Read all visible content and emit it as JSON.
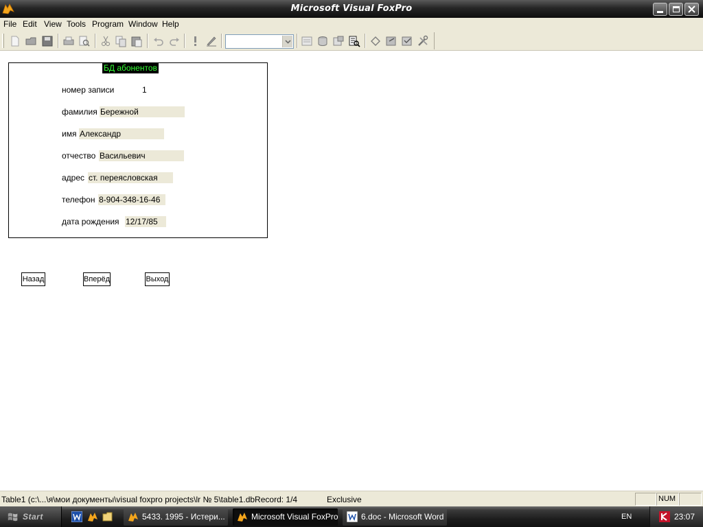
{
  "window": {
    "title": "Microsoft Visual FoxPro"
  },
  "menu": [
    "File",
    "Edit",
    "View",
    "Tools",
    "Program",
    "Window",
    "Help"
  ],
  "toolbar": {
    "combo_value": ""
  },
  "form": {
    "title": "БД абонентов",
    "record_number": {
      "label": "номер записи",
      "value": "1"
    },
    "surname": {
      "label": "фамилия",
      "value": "Бережной"
    },
    "name": {
      "label": "имя",
      "value": "Александр"
    },
    "patronymic": {
      "label": "отчество",
      "value": "Васильевич"
    },
    "address": {
      "label": "адрес",
      "value": "ст. переясловская"
    },
    "phone": {
      "label": "телефон",
      "value": "8-904-348-16-46"
    },
    "birthdate": {
      "label": "дата рождения",
      "value": "12/17/85"
    }
  },
  "buttons": {
    "back": "Назад",
    "forward": "Вперёд",
    "exit": "Выход"
  },
  "status": {
    "path": "Table1 (c:\\...\\я\\мои документы\\visual foxpro projects\\lr № 5\\table1.dbRecord: 1/4",
    "mode": "Exclusive",
    "num": "NUM"
  },
  "taskbar": {
    "start": "Start",
    "tasks": [
      {
        "label": "5433. 1995 - Истери...",
        "active": false
      },
      {
        "label": "Microsoft Visual FoxPro",
        "active": true
      },
      {
        "label": "6.doc - Microsoft Word",
        "active": false
      }
    ],
    "lang": "EN",
    "clock": "23:07"
  },
  "colors": {
    "form_title_bg": "#000000",
    "form_title_fg": "#35ff35",
    "field_bg": "#ece9d8"
  }
}
